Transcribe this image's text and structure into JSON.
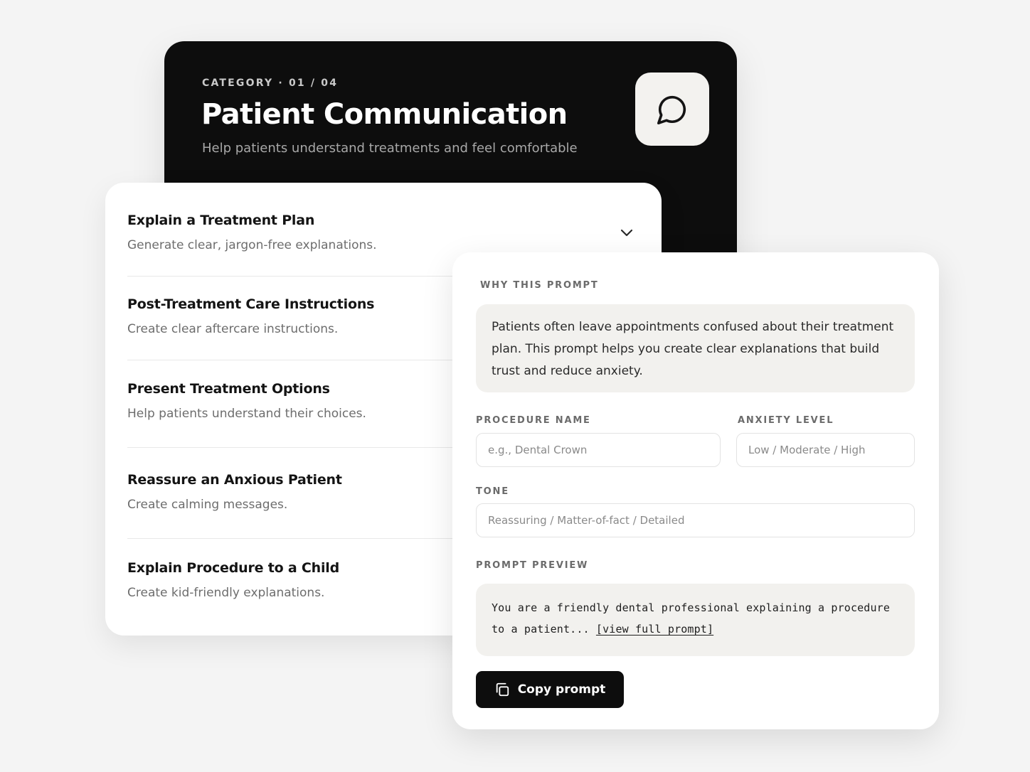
{
  "category": {
    "eyebrow": "CATEGORY · 01 / 04",
    "title": "Patient Communication",
    "subtitle": "Help patients understand treatments and feel comfortable",
    "icon": "chat-bubble-icon"
  },
  "prompts": {
    "items": [
      {
        "title": "Explain a Treatment Plan",
        "description": "Generate clear, jargon-free explanations.",
        "expanded": true
      },
      {
        "title": "Post-Treatment Care Instructions",
        "description": "Create clear aftercare instructions."
      },
      {
        "title": "Present Treatment Options",
        "description": "Help patients understand their choices."
      },
      {
        "title": "Reassure an Anxious Patient",
        "description": "Create calming messages."
      },
      {
        "title": "Explain Procedure to a Child",
        "description": "Create kid-friendly explanations."
      }
    ],
    "toggle_icon": "chevron-down-icon"
  },
  "detail": {
    "why_label": "WHY THIS PROMPT",
    "why_text": "Patients often leave appointments confused about their treatment plan. This prompt helps you create clear explanations that build trust and reduce anxiety.",
    "fields": {
      "procedure": {
        "label": "PROCEDURE NAME",
        "placeholder": "e.g., Dental Crown",
        "value": ""
      },
      "anxiety": {
        "label": "ANXIETY LEVEL",
        "placeholder": "Low / Moderate / High",
        "value": ""
      },
      "tone": {
        "label": "TONE",
        "placeholder": "Reassuring / Matter-of-fact / Detailed",
        "value": ""
      }
    },
    "preview_label": "PROMPT PREVIEW",
    "preview_text": "You are a friendly dental professional explaining a procedure to a patient... ",
    "preview_link": "[view full prompt]",
    "copy_label": "Copy prompt",
    "copy_icon": "copy-icon"
  },
  "colors": {
    "background": "#f4f4f4",
    "dark_card": "#0d0d0d",
    "tinted_box": "#f2f1ee",
    "button": "#0d0d0d"
  }
}
